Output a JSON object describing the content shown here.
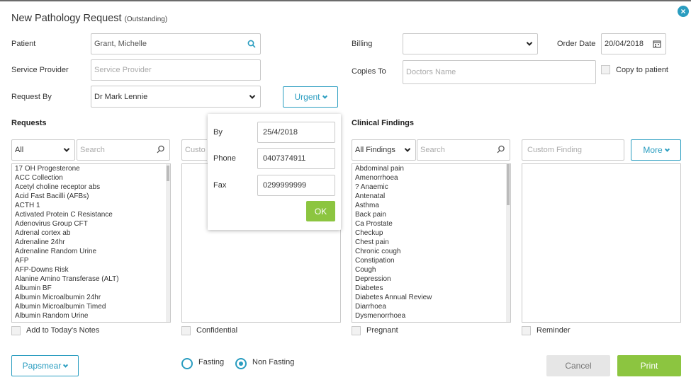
{
  "header": {
    "title": "New Pathology Request",
    "subtitle": "(Outstanding)"
  },
  "form": {
    "patient_label": "Patient",
    "patient_value": "Grant, Michelle",
    "service_provider_label": "Service Provider",
    "service_provider_placeholder": "Service Provider",
    "request_by_label": "Request By",
    "request_by_value": "Dr Mark Lennie",
    "urgent_label": "Urgent",
    "billing_label": "Billing",
    "billing_value": "",
    "order_date_label": "Order Date",
    "order_date_value": "20/04/2018",
    "copies_to_label": "Copies To",
    "copies_to_placeholder": "Doctors Name",
    "copy_to_patient_label": "Copy to patient"
  },
  "urgent_popup": {
    "by_label": "By",
    "by_value": "25/4/2018",
    "phone_label": "Phone",
    "phone_value": "0407374911",
    "fax_label": "Fax",
    "fax_value": "0299999999",
    "ok_label": "OK"
  },
  "requests": {
    "heading": "Requests",
    "filter_value": "All",
    "search_placeholder": "Search",
    "custom_placeholder": "Custo",
    "items": [
      "17 OH Progesterone",
      "ACC Collection",
      "Acetyl choline receptor abs",
      "Acid Fast Bacilli (AFBs)",
      "ACTH 1",
      "Activated Protein C Resistance",
      "Adenovirus Group CFT",
      "Adrenal cortex ab",
      "Adrenaline 24hr",
      "Adrenaline Random Urine",
      "AFP",
      "AFP-Downs Risk",
      "Alanine Amino Transferase (ALT)",
      "Albumin BF",
      "Albumin Microalbumin 24hr",
      "Albumin Microalbumin Timed",
      "Albumin Random Urine"
    ]
  },
  "clinical": {
    "heading": "Clinical Findings",
    "filter_value": "All Findings",
    "search_placeholder": "Search",
    "custom_placeholder": "Custom Finding",
    "more_label": "More",
    "items": [
      "Abdominal pain",
      "Amenorrhoea",
      "? Anaemic",
      "Antenatal",
      "Asthma",
      "Back pain",
      "Ca Prostate",
      "Checkup",
      "Chest pain",
      "Chronic cough",
      "Constipation",
      "Cough",
      "Depression",
      "Diabetes",
      "Diabetes Annual Review",
      "Diarrhoea",
      "Dysmenorrhoea"
    ]
  },
  "checkboxes": {
    "add_to_notes": "Add to Today's Notes",
    "confidential": "Confidential",
    "pregnant": "Pregnant",
    "reminder": "Reminder"
  },
  "footer": {
    "papsmear_label": "Papsmear",
    "fasting_label": "Fasting",
    "non_fasting_label": "Non Fasting",
    "fasting_selected": "Non Fasting",
    "cancel_label": "Cancel",
    "print_label": "Print"
  },
  "icons": {
    "search": "search-icon",
    "calendar": "calendar-icon",
    "close": "close-icon",
    "chevron": "chevron-down-icon"
  },
  "colors": {
    "accent": "#2a9dc0",
    "print": "#8cc540",
    "cancel": "#e6e6e6"
  }
}
